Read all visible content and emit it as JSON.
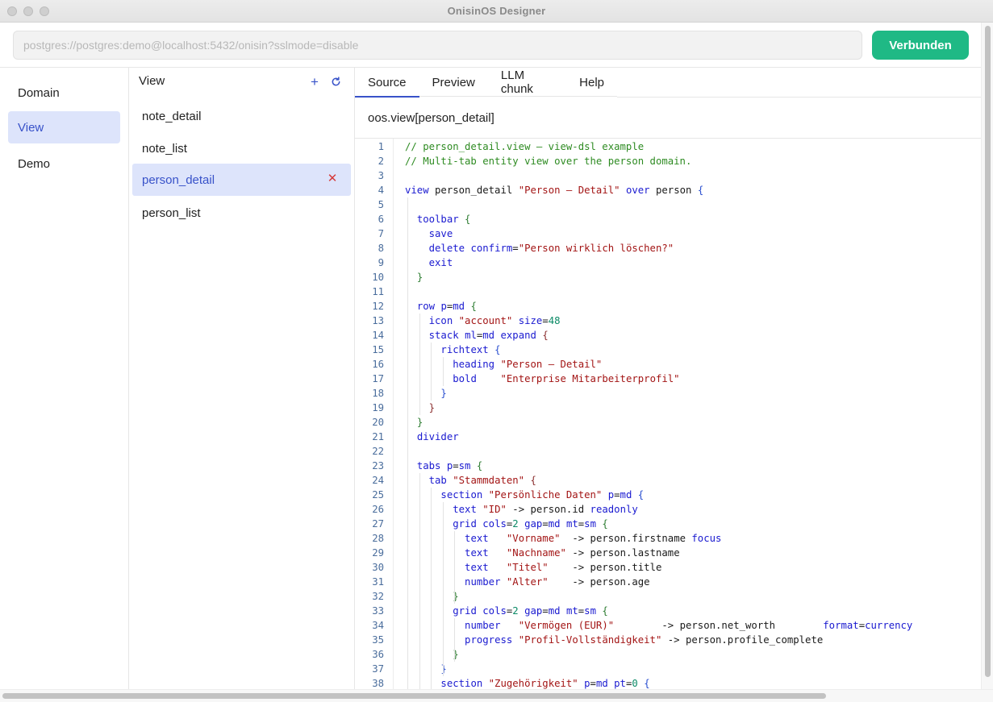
{
  "window": {
    "title": "OnisinOS Designer"
  },
  "connection": {
    "placeholder": "postgres://postgres:demo@localhost:5432/onisin?sslmode=disable",
    "button_label": "Verbunden",
    "button_color": "#1fb985"
  },
  "nav": {
    "items": [
      {
        "label": "Domain",
        "active": false
      },
      {
        "label": "View",
        "active": true
      },
      {
        "label": "Demo",
        "active": false
      }
    ]
  },
  "view_panel": {
    "title": "View",
    "add_icon": "plus-icon",
    "refresh_icon": "refresh-icon",
    "delete_icon": "close-icon",
    "items": [
      {
        "label": "note_detail",
        "active": false
      },
      {
        "label": "note_list",
        "active": false
      },
      {
        "label": "person_detail",
        "active": true
      },
      {
        "label": "person_list",
        "active": false
      }
    ]
  },
  "editor": {
    "tabs": [
      {
        "label": "Source",
        "active": true
      },
      {
        "label": "Preview",
        "active": false
      },
      {
        "label": "LLM chunk",
        "active": false
      },
      {
        "label": "Help",
        "active": false
      }
    ],
    "view_name": "oos.view[person_detail]",
    "code_lines": [
      [
        [
          "com",
          "// person_detail.view — view-dsl example"
        ]
      ],
      [
        [
          "com",
          "// Multi-tab entity view over the person domain."
        ]
      ],
      [],
      [
        [
          "kw",
          "view"
        ],
        [
          "pl",
          " person_detail "
        ],
        [
          "str",
          "\"Person — Detail\""
        ],
        [
          "pl",
          " "
        ],
        [
          "kw",
          "over"
        ],
        [
          "pl",
          " person "
        ],
        [
          "brb",
          "{"
        ]
      ],
      [],
      [
        [
          "pl",
          "  "
        ],
        [
          "kw",
          "toolbar"
        ],
        [
          "pl",
          " "
        ],
        [
          "brg",
          "{"
        ]
      ],
      [
        [
          "pl",
          "    "
        ],
        [
          "kw",
          "save"
        ]
      ],
      [
        [
          "pl",
          "    "
        ],
        [
          "kw",
          "delete"
        ],
        [
          "pl",
          " "
        ],
        [
          "kw",
          "confirm"
        ],
        [
          "pl",
          "="
        ],
        [
          "str",
          "\"Person wirklich löschen?\""
        ]
      ],
      [
        [
          "pl",
          "    "
        ],
        [
          "kw",
          "exit"
        ]
      ],
      [
        [
          "pl",
          "  "
        ],
        [
          "brg",
          "}"
        ]
      ],
      [],
      [
        [
          "pl",
          "  "
        ],
        [
          "kw",
          "row"
        ],
        [
          "pl",
          " "
        ],
        [
          "kw",
          "p"
        ],
        [
          "pl",
          "="
        ],
        [
          "kw",
          "md"
        ],
        [
          "pl",
          " "
        ],
        [
          "brg",
          "{"
        ]
      ],
      [
        [
          "pl",
          "    "
        ],
        [
          "kw",
          "icon"
        ],
        [
          "pl",
          " "
        ],
        [
          "str",
          "\"account\""
        ],
        [
          "pl",
          " "
        ],
        [
          "kw",
          "size"
        ],
        [
          "pl",
          "="
        ],
        [
          "num",
          "48"
        ]
      ],
      [
        [
          "pl",
          "    "
        ],
        [
          "kw",
          "stack"
        ],
        [
          "pl",
          " "
        ],
        [
          "kw",
          "ml"
        ],
        [
          "pl",
          "="
        ],
        [
          "kw",
          "md"
        ],
        [
          "pl",
          " "
        ],
        [
          "kw",
          "expand"
        ],
        [
          "pl",
          " "
        ],
        [
          "brr",
          "{"
        ]
      ],
      [
        [
          "pl",
          "      "
        ],
        [
          "kw",
          "richtext"
        ],
        [
          "pl",
          " "
        ],
        [
          "brb",
          "{"
        ]
      ],
      [
        [
          "pl",
          "        "
        ],
        [
          "kw",
          "heading"
        ],
        [
          "pl",
          " "
        ],
        [
          "str",
          "\"Person — Detail\""
        ]
      ],
      [
        [
          "pl",
          "        "
        ],
        [
          "kw",
          "bold"
        ],
        [
          "pl",
          "    "
        ],
        [
          "str",
          "\"Enterprise Mitarbeiterprofil\""
        ]
      ],
      [
        [
          "pl",
          "      "
        ],
        [
          "brb",
          "}"
        ]
      ],
      [
        [
          "pl",
          "    "
        ],
        [
          "brr",
          "}"
        ]
      ],
      [
        [
          "pl",
          "  "
        ],
        [
          "brg",
          "}"
        ]
      ],
      [
        [
          "pl",
          "  "
        ],
        [
          "kw",
          "divider"
        ]
      ],
      [],
      [
        [
          "pl",
          "  "
        ],
        [
          "kw",
          "tabs"
        ],
        [
          "pl",
          " "
        ],
        [
          "kw",
          "p"
        ],
        [
          "pl",
          "="
        ],
        [
          "kw",
          "sm"
        ],
        [
          "pl",
          " "
        ],
        [
          "brg",
          "{"
        ]
      ],
      [
        [
          "pl",
          "    "
        ],
        [
          "kw",
          "tab"
        ],
        [
          "pl",
          " "
        ],
        [
          "str",
          "\"Stammdaten\""
        ],
        [
          "pl",
          " "
        ],
        [
          "brr",
          "{"
        ]
      ],
      [
        [
          "pl",
          "      "
        ],
        [
          "kw",
          "section"
        ],
        [
          "pl",
          " "
        ],
        [
          "str",
          "\"Persönliche Daten\""
        ],
        [
          "pl",
          " "
        ],
        [
          "kw",
          "p"
        ],
        [
          "pl",
          "="
        ],
        [
          "kw",
          "md"
        ],
        [
          "pl",
          " "
        ],
        [
          "brb",
          "{"
        ]
      ],
      [
        [
          "pl",
          "        "
        ],
        [
          "kw",
          "text"
        ],
        [
          "pl",
          " "
        ],
        [
          "str",
          "\"ID\""
        ],
        [
          "pl",
          " -> person.id "
        ],
        [
          "kw",
          "readonly"
        ]
      ],
      [
        [
          "pl",
          "        "
        ],
        [
          "kw",
          "grid"
        ],
        [
          "pl",
          " "
        ],
        [
          "kw",
          "cols"
        ],
        [
          "pl",
          "="
        ],
        [
          "num",
          "2"
        ],
        [
          "pl",
          " "
        ],
        [
          "kw",
          "gap"
        ],
        [
          "pl",
          "="
        ],
        [
          "kw",
          "md"
        ],
        [
          "pl",
          " "
        ],
        [
          "kw",
          "mt"
        ],
        [
          "pl",
          "="
        ],
        [
          "kw",
          "sm"
        ],
        [
          "pl",
          " "
        ],
        [
          "brg",
          "{"
        ]
      ],
      [
        [
          "pl",
          "          "
        ],
        [
          "kw",
          "text"
        ],
        [
          "pl",
          "   "
        ],
        [
          "str",
          "\"Vorname\""
        ],
        [
          "pl",
          "  -> person.firstname "
        ],
        [
          "kw",
          "focus"
        ]
      ],
      [
        [
          "pl",
          "          "
        ],
        [
          "kw",
          "text"
        ],
        [
          "pl",
          "   "
        ],
        [
          "str",
          "\"Nachname\""
        ],
        [
          "pl",
          " -> person.lastname"
        ]
      ],
      [
        [
          "pl",
          "          "
        ],
        [
          "kw",
          "text"
        ],
        [
          "pl",
          "   "
        ],
        [
          "str",
          "\"Titel\""
        ],
        [
          "pl",
          "    -> person.title"
        ]
      ],
      [
        [
          "pl",
          "          "
        ],
        [
          "kw",
          "number"
        ],
        [
          "pl",
          " "
        ],
        [
          "str",
          "\"Alter\""
        ],
        [
          "pl",
          "    -> person.age"
        ]
      ],
      [
        [
          "pl",
          "        "
        ],
        [
          "brg",
          "}"
        ]
      ],
      [
        [
          "pl",
          "        "
        ],
        [
          "kw",
          "grid"
        ],
        [
          "pl",
          " "
        ],
        [
          "kw",
          "cols"
        ],
        [
          "pl",
          "="
        ],
        [
          "num",
          "2"
        ],
        [
          "pl",
          " "
        ],
        [
          "kw",
          "gap"
        ],
        [
          "pl",
          "="
        ],
        [
          "kw",
          "md"
        ],
        [
          "pl",
          " "
        ],
        [
          "kw",
          "mt"
        ],
        [
          "pl",
          "="
        ],
        [
          "kw",
          "sm"
        ],
        [
          "pl",
          " "
        ],
        [
          "brg",
          "{"
        ]
      ],
      [
        [
          "pl",
          "          "
        ],
        [
          "kw",
          "number"
        ],
        [
          "pl",
          "   "
        ],
        [
          "str",
          "\"Vermögen (EUR)\""
        ],
        [
          "pl",
          "        -> person.net_worth        "
        ],
        [
          "kw",
          "format"
        ],
        [
          "pl",
          "="
        ],
        [
          "kw",
          "currency"
        ]
      ],
      [
        [
          "pl",
          "          "
        ],
        [
          "kw",
          "progress"
        ],
        [
          "pl",
          " "
        ],
        [
          "str",
          "\"Profil-Vollständigkeit\""
        ],
        [
          "pl",
          " -> person.profile_complete"
        ]
      ],
      [
        [
          "pl",
          "        "
        ],
        [
          "brg",
          "}"
        ]
      ],
      [
        [
          "pl",
          "      "
        ],
        [
          "brb",
          "}"
        ]
      ],
      [
        [
          "pl",
          "      "
        ],
        [
          "kw",
          "section"
        ],
        [
          "pl",
          " "
        ],
        [
          "str",
          "\"Zugehörigkeit\""
        ],
        [
          "pl",
          " "
        ],
        [
          "kw",
          "p"
        ],
        [
          "pl",
          "="
        ],
        [
          "kw",
          "md"
        ],
        [
          "pl",
          " "
        ],
        [
          "kw",
          "pt"
        ],
        [
          "pl",
          "="
        ],
        [
          "num",
          "0"
        ],
        [
          "pl",
          " "
        ],
        [
          "brb",
          "{"
        ]
      ]
    ]
  }
}
